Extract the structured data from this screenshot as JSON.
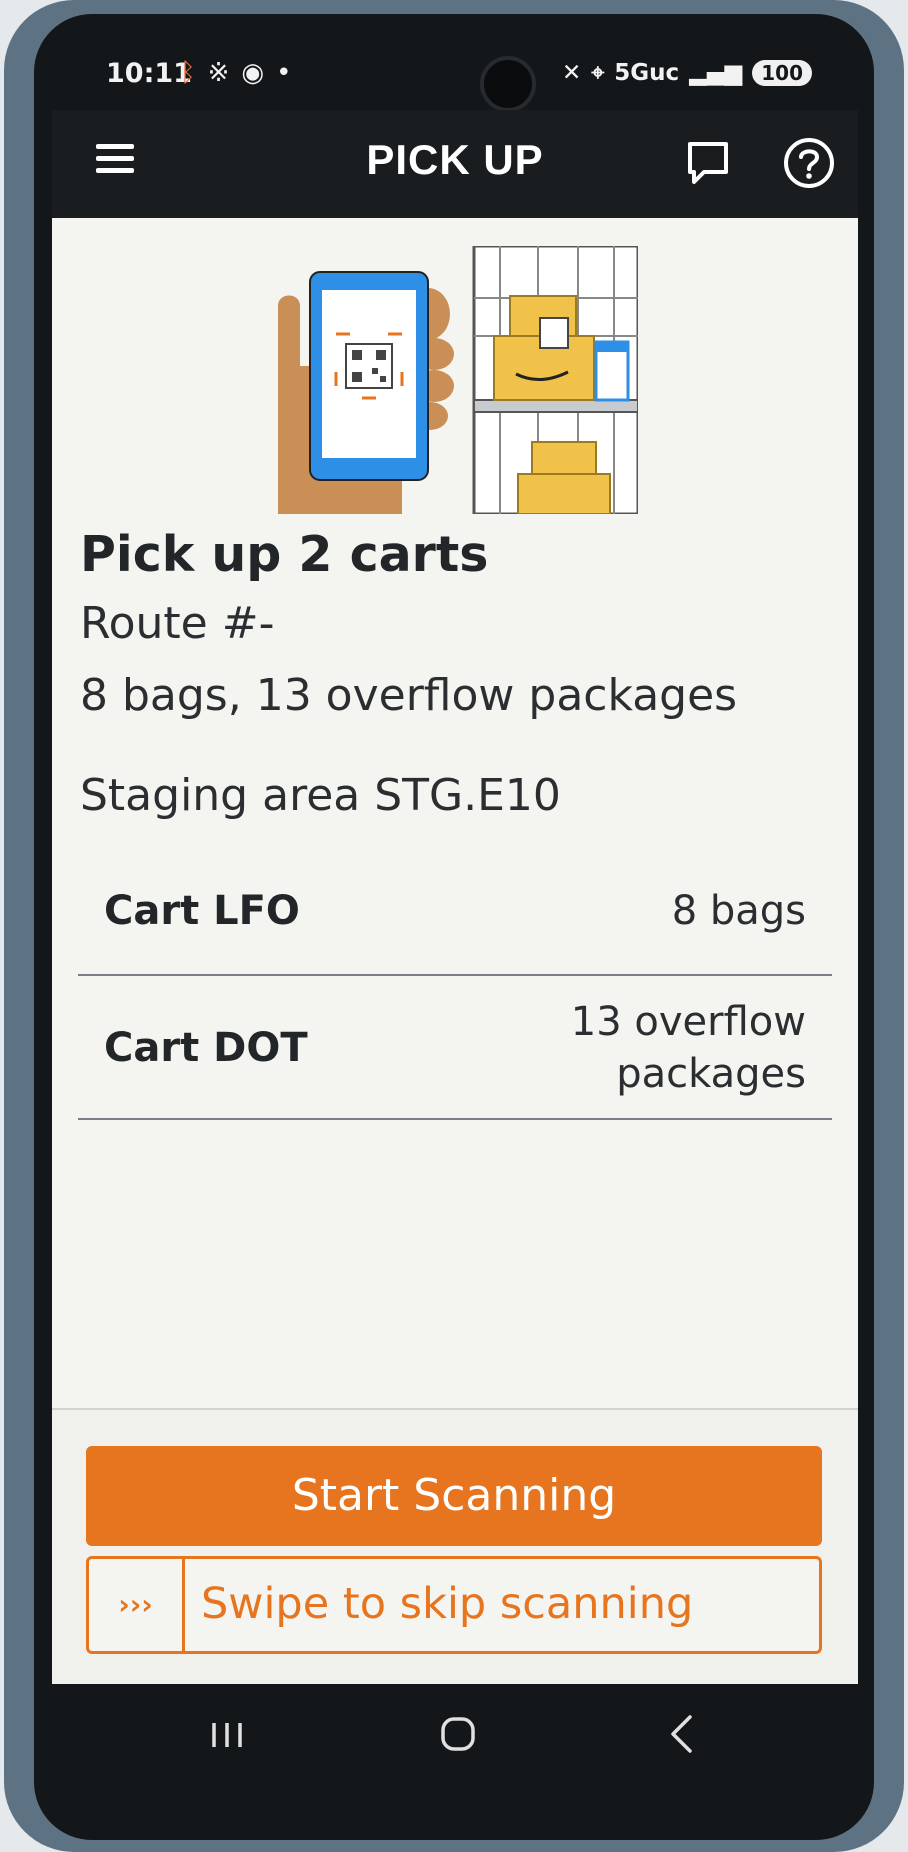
{
  "status_bar": {
    "time": "10:11",
    "network": "5Guc",
    "battery": "100"
  },
  "header": {
    "title": "PICK UP"
  },
  "main": {
    "title": "Pick up 2 carts",
    "route": "Route #-",
    "summary": "8 bags, 13 overflow packages",
    "staging_area": "Staging area STG.E10",
    "carts": [
      {
        "name": "Cart LFO",
        "value": "8 bags"
      },
      {
        "name": "Cart DOT",
        "value_line1": "13 overflow",
        "value_line2": "packages"
      }
    ]
  },
  "footer": {
    "start_button_label": "Start Scanning",
    "swipe_handle_glyph": "›››",
    "swipe_label": "Swipe to skip scanning"
  },
  "colors": {
    "accent": "#e7751f",
    "header_bg": "#1a1d20",
    "screen_bg": "#f4f4f1",
    "case": "#5d7384"
  },
  "icons": {
    "menu": "menu-icon",
    "chat": "chat-icon",
    "help": "help-icon",
    "bluetooth": "bluetooth-icon",
    "nfc": "nfc-icon",
    "mute": "mute-icon",
    "location": "location-icon",
    "signal": "signal-icon"
  }
}
